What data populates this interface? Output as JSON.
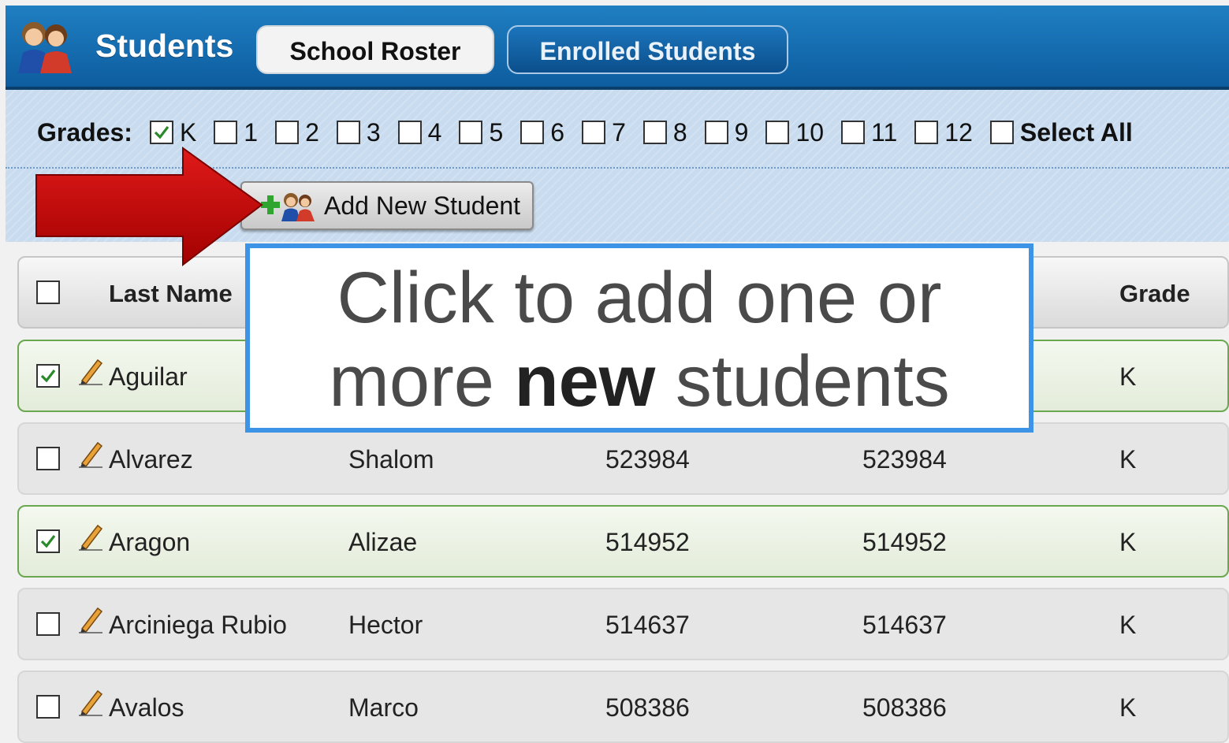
{
  "header": {
    "title": "Students",
    "tabs": [
      {
        "label": "School Roster",
        "active": true
      },
      {
        "label": "Enrolled Students",
        "active": false
      }
    ]
  },
  "filters": {
    "grades_label": "Grades:",
    "grades": [
      {
        "label": "K",
        "checked": true
      },
      {
        "label": "1",
        "checked": false
      },
      {
        "label": "2",
        "checked": false
      },
      {
        "label": "3",
        "checked": false
      },
      {
        "label": "4",
        "checked": false
      },
      {
        "label": "5",
        "checked": false
      },
      {
        "label": "6",
        "checked": false
      },
      {
        "label": "7",
        "checked": false
      },
      {
        "label": "8",
        "checked": false
      },
      {
        "label": "9",
        "checked": false
      },
      {
        "label": "10",
        "checked": false
      },
      {
        "label": "11",
        "checked": false
      },
      {
        "label": "12",
        "checked": false
      }
    ],
    "select_all_label": "Select All",
    "select_all_checked": false
  },
  "toolbar": {
    "add_button_label": "Add New Student"
  },
  "table": {
    "columns": {
      "last_name": "Last Name",
      "grade": "Grade"
    },
    "rows": [
      {
        "last_name": "Aguilar",
        "first_name": "",
        "id1": "",
        "id2": "",
        "grade": "K",
        "checked": true
      },
      {
        "last_name": "Alvarez",
        "first_name": "Shalom",
        "id1": "523984",
        "id2": "523984",
        "grade": "K",
        "checked": false
      },
      {
        "last_name": "Aragon",
        "first_name": "Alizae",
        "id1": "514952",
        "id2": "514952",
        "grade": "K",
        "checked": true
      },
      {
        "last_name": "Arciniega Rubio",
        "first_name": "Hector",
        "id1": "514637",
        "id2": "514637",
        "grade": "K",
        "checked": false
      },
      {
        "last_name": "Avalos",
        "first_name": "Marco",
        "id1": "508386",
        "id2": "508386",
        "grade": "K",
        "checked": false
      }
    ]
  },
  "callout": {
    "line1": "Click to add one or",
    "line2_pre": "more ",
    "line2_bold": "new",
    "line2_post": " students"
  },
  "colors": {
    "header_blue": "#0d5d9f",
    "filter_bg": "#c9dcef",
    "selected_row_border": "#6aa84f",
    "arrow_red": "#cc0000",
    "callout_border": "#3d94e6"
  }
}
